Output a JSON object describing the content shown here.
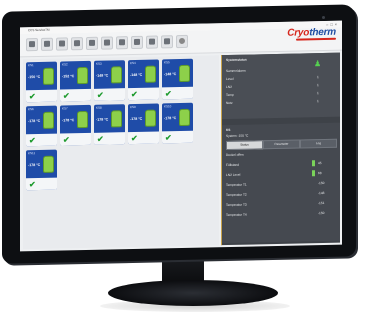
{
  "window": {
    "title": "CCS ServiceTM"
  },
  "toolbar": {
    "buttons": [
      "toggle-icon",
      "lock-icon",
      "refresh-icon",
      "page-icon",
      "page-icon",
      "page-icon",
      "page-icon",
      "page-icon",
      "page-icon",
      "page-icon",
      "info-icon"
    ]
  },
  "brand": {
    "logo_text_a": "Cryo",
    "logo_text_b": "therm",
    "accent": "#d6261c",
    "brand_blue": "#1f4ea3"
  },
  "tiles": [
    {
      "title": "KS1",
      "temp": "-150 °C"
    },
    {
      "title": "KS2",
      "temp": "-152 °C"
    },
    {
      "title": "KS3",
      "temp": "-148 °C"
    },
    {
      "title": "KS4",
      "temp": "-148 °C"
    },
    {
      "title": "KS5",
      "temp": "-148 °C"
    },
    {
      "title": "KS6",
      "temp": "-178 °C"
    },
    {
      "title": "KS7",
      "temp": "-178 °C"
    },
    {
      "title": "KS8",
      "temp": "-178 °C"
    },
    {
      "title": "KS9",
      "temp": "-178 °C"
    },
    {
      "title": "KS10",
      "temp": "-178 °C"
    },
    {
      "title": "KS11",
      "temp": "-178 °C"
    }
  ],
  "right_panel": {
    "system": {
      "title": "Systemstatus",
      "rows": [
        {
          "label": "Sammelalarm",
          "value": ""
        },
        {
          "label": "Level",
          "value": "1"
        },
        {
          "label": "LN2",
          "value": "1"
        },
        {
          "label": "Temp",
          "value": "1"
        },
        {
          "label": "Netz",
          "value": "1"
        }
      ]
    },
    "detail": {
      "title": "KS",
      "subtitle": "System -150 °C",
      "tabs": [
        "Status",
        "Parameter",
        "Log"
      ],
      "rows": [
        {
          "label": "Deckel offen",
          "value": ""
        },
        {
          "label": "Füllstand",
          "value": "45"
        },
        {
          "label": "LN2 Level",
          "value": "68"
        },
        {
          "label": "Temperatur T1",
          "value": "-150"
        },
        {
          "label": "Temperatur T2",
          "value": "-148"
        },
        {
          "label": "Temperatur T3",
          "value": "-151"
        },
        {
          "label": "Temperatur T4",
          "value": "-150"
        }
      ]
    }
  }
}
